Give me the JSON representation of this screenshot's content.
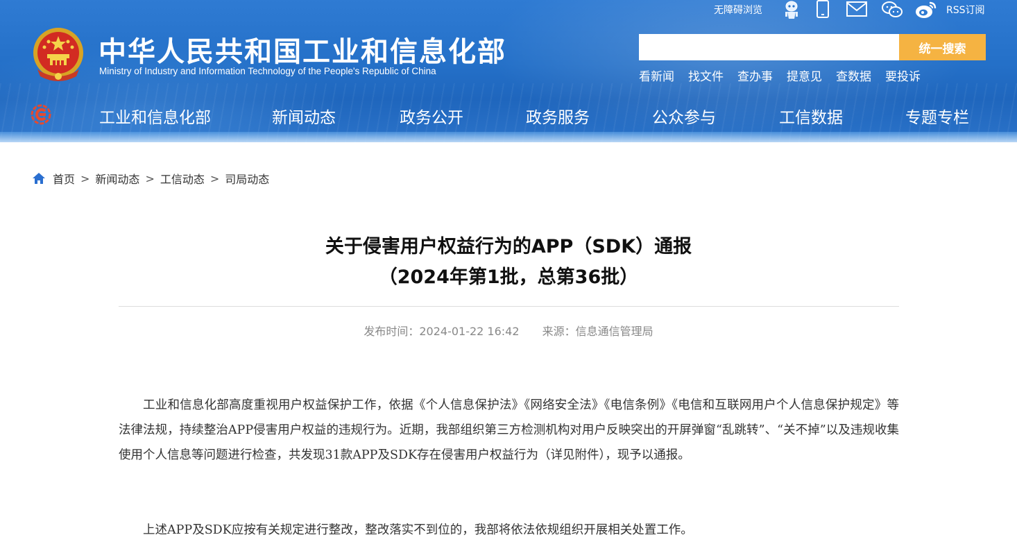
{
  "header": {
    "title_cn": "中华人民共和国工业和信息化部",
    "title_en": "Ministry of Industry and Information Technology of the People's Republic of China",
    "accessibility": "无障碍浏览",
    "rss": "RSS订阅",
    "icons": [
      "robot-icon",
      "mobile-icon",
      "mail-icon",
      "wechat-icon",
      "weibo-icon"
    ],
    "search_placeholder": "",
    "search_button": "统一搜索",
    "quick_links": [
      "看新闻",
      "找文件",
      "查办事",
      "提意见",
      "查数据",
      "要投诉"
    ]
  },
  "nav": {
    "items": [
      "工业和信息化部",
      "新闻动态",
      "政务公开",
      "政务服务",
      "公众参与",
      "工信数据",
      "专题专栏"
    ]
  },
  "breadcrumb": {
    "items": [
      "首页",
      "新闻动态",
      "工信动态",
      "司局动态"
    ],
    "separator": ">"
  },
  "article": {
    "title_line1": "关于侵害用户权益行为的APP（SDK）通报",
    "title_line2": "（2024年第1批，总第36批）",
    "publish_label": "发布时间：2024-01-22 16:42",
    "source_label": "来源：信息通信管理局",
    "paragraphs": [
      "工业和信息化部高度重视用户权益保护工作，依据《个人信息保护法》《网络安全法》《电信条例》《电信和互联网用户个人信息保护规定》等法律法规，持续整治APP侵害用户权益的违规行为。近期，我部组织第三方检测机构对用户反映突出的开屏弹窗“乱跳转”、“关不掉”以及违规收集使用个人信息等问题进行检查，共发现31款APP及SDK存在侵害用户权益行为（详见附件），现予以通报。",
      "上述APP及SDK应按有关规定进行整改，整改落实不到位的，我部将依法依规组织开展相关处置工作。"
    ]
  },
  "colors": {
    "header_blue": "#2470c8",
    "search_button": "#f5b342",
    "breadcrumb_icon": "#2a6fd0"
  }
}
